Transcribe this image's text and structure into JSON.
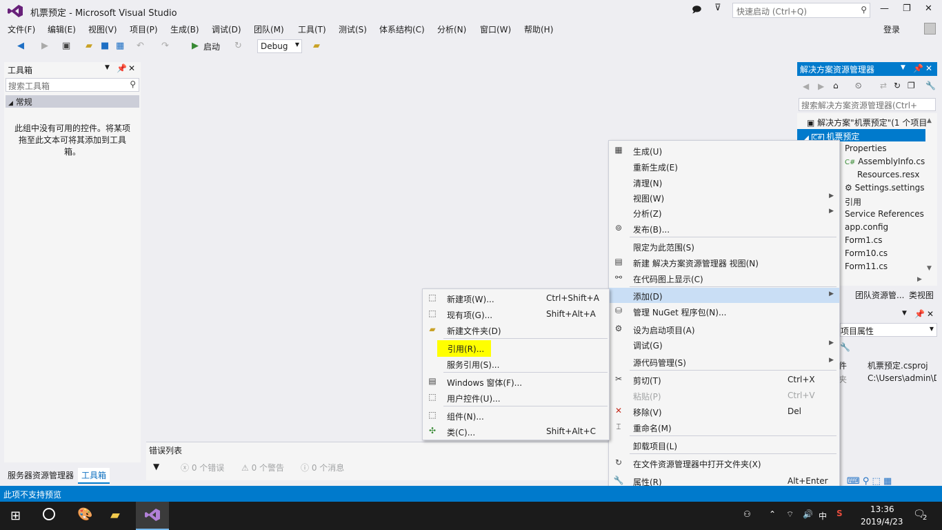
{
  "window": {
    "title": "机票预定 - Microsoft Visual Studio",
    "quick_launch_placeholder": "快速启动 (Ctrl+Q)",
    "login": "登录"
  },
  "menu": [
    "文件(F)",
    "编辑(E)",
    "视图(V)",
    "项目(P)",
    "生成(B)",
    "调试(D)",
    "团队(M)",
    "工具(T)",
    "测试(S)",
    "体系结构(C)",
    "分析(N)",
    "窗口(W)",
    "帮助(H)"
  ],
  "toolbar": {
    "start": "启动",
    "config": "Debug"
  },
  "toolbox": {
    "title": "工具箱",
    "search": "搜索工具箱",
    "group": "常规",
    "empty_text": "此组中没有可用的控件。将某项拖至此文本可将其添加到工具箱。"
  },
  "bottom_tabs": [
    "服务器资源管理器",
    "工具箱"
  ],
  "error_list": {
    "title": "错误列表",
    "errors": "0 个错误",
    "warnings": "0 个警告",
    "messages": "0 个消息"
  },
  "solution_explorer": {
    "title": "解决方案资源管理器",
    "search": "搜索解决方案资源管理器(Ctrl+",
    "solution": "解决方案\"机票预定\"(1 个项目",
    "project": "机票预定",
    "items": [
      "Properties",
      "AssemblyInfo.cs",
      "Resources.resx",
      "Settings.settings",
      "引用",
      "Service References",
      "app.config",
      "Form1.cs",
      "Form10.cs",
      "Form11.cs"
    ],
    "tabs": [
      "团队资源管...",
      "类视图"
    ]
  },
  "properties": {
    "title": "项目属性",
    "row1_label": "件",
    "row1_value": "机票预定.csproj",
    "row2_label": "夹",
    "row2_value": "C:\\Users\\admin\\D"
  },
  "context_menu": [
    {
      "label": "生成(U)",
      "shortcut": "",
      "icon": "build-icon"
    },
    {
      "label": "重新生成(E)",
      "shortcut": ""
    },
    {
      "label": "清理(N)",
      "shortcut": ""
    },
    {
      "label": "视图(W)",
      "shortcut": "",
      "submenu": true
    },
    {
      "label": "分析(Z)",
      "shortcut": "",
      "submenu": true
    },
    {
      "label": "发布(B)...",
      "shortcut": "",
      "icon": "publish-icon"
    },
    {
      "label": "限定为此范围(S)",
      "shortcut": ""
    },
    {
      "label": "新建 解决方案资源管理器 视图(N)",
      "shortcut": "",
      "icon": "new-view-icon"
    },
    {
      "label": "在代码图上显示(C)",
      "shortcut": "",
      "icon": "code-map-icon"
    },
    {
      "label": "添加(D)",
      "shortcut": "",
      "submenu": true,
      "highlighted": true
    },
    {
      "label": "管理 NuGet 程序包(N)...",
      "shortcut": "",
      "icon": "nuget-icon"
    },
    {
      "label": "设为启动项目(A)",
      "shortcut": "",
      "icon": "gear-icon"
    },
    {
      "label": "调试(G)",
      "shortcut": "",
      "submenu": true
    },
    {
      "label": "源代码管理(S)",
      "shortcut": "",
      "submenu": true
    },
    {
      "label": "剪切(T)",
      "shortcut": "Ctrl+X",
      "icon": "cut-icon"
    },
    {
      "label": "粘贴(P)",
      "shortcut": "Ctrl+V",
      "disabled": true
    },
    {
      "label": "移除(V)",
      "shortcut": "Del",
      "icon": "remove-icon"
    },
    {
      "label": "重命名(M)",
      "shortcut": "",
      "icon": "rename-icon"
    },
    {
      "label": "卸载项目(L)",
      "shortcut": ""
    },
    {
      "label": "在文件资源管理器中打开文件夹(X)",
      "shortcut": "",
      "icon": "refresh-icon"
    },
    {
      "label": "属性(R)",
      "shortcut": "Alt+Enter",
      "icon": "wrench-icon"
    }
  ],
  "add_submenu": [
    {
      "label": "新建项(W)...",
      "shortcut": "Ctrl+Shift+A"
    },
    {
      "label": "现有项(G)...",
      "shortcut": "Shift+Alt+A"
    },
    {
      "label": "新建文件夹(D)",
      "shortcut": ""
    },
    {
      "label": "引用(R)...",
      "shortcut": "",
      "highlighted_yellow": true
    },
    {
      "label": "服务引用(S)...",
      "shortcut": ""
    },
    {
      "label": "Windows 窗体(F)...",
      "shortcut": ""
    },
    {
      "label": "用户控件(U)...",
      "shortcut": ""
    },
    {
      "label": "组件(N)...",
      "shortcut": ""
    },
    {
      "label": "类(C)...",
      "shortcut": "Shift+Alt+C"
    }
  ],
  "status": "此项不支持预览",
  "taskbar": {
    "time": "13:36",
    "date": "2019/4/23",
    "ime": "中",
    "notifications": "2"
  }
}
